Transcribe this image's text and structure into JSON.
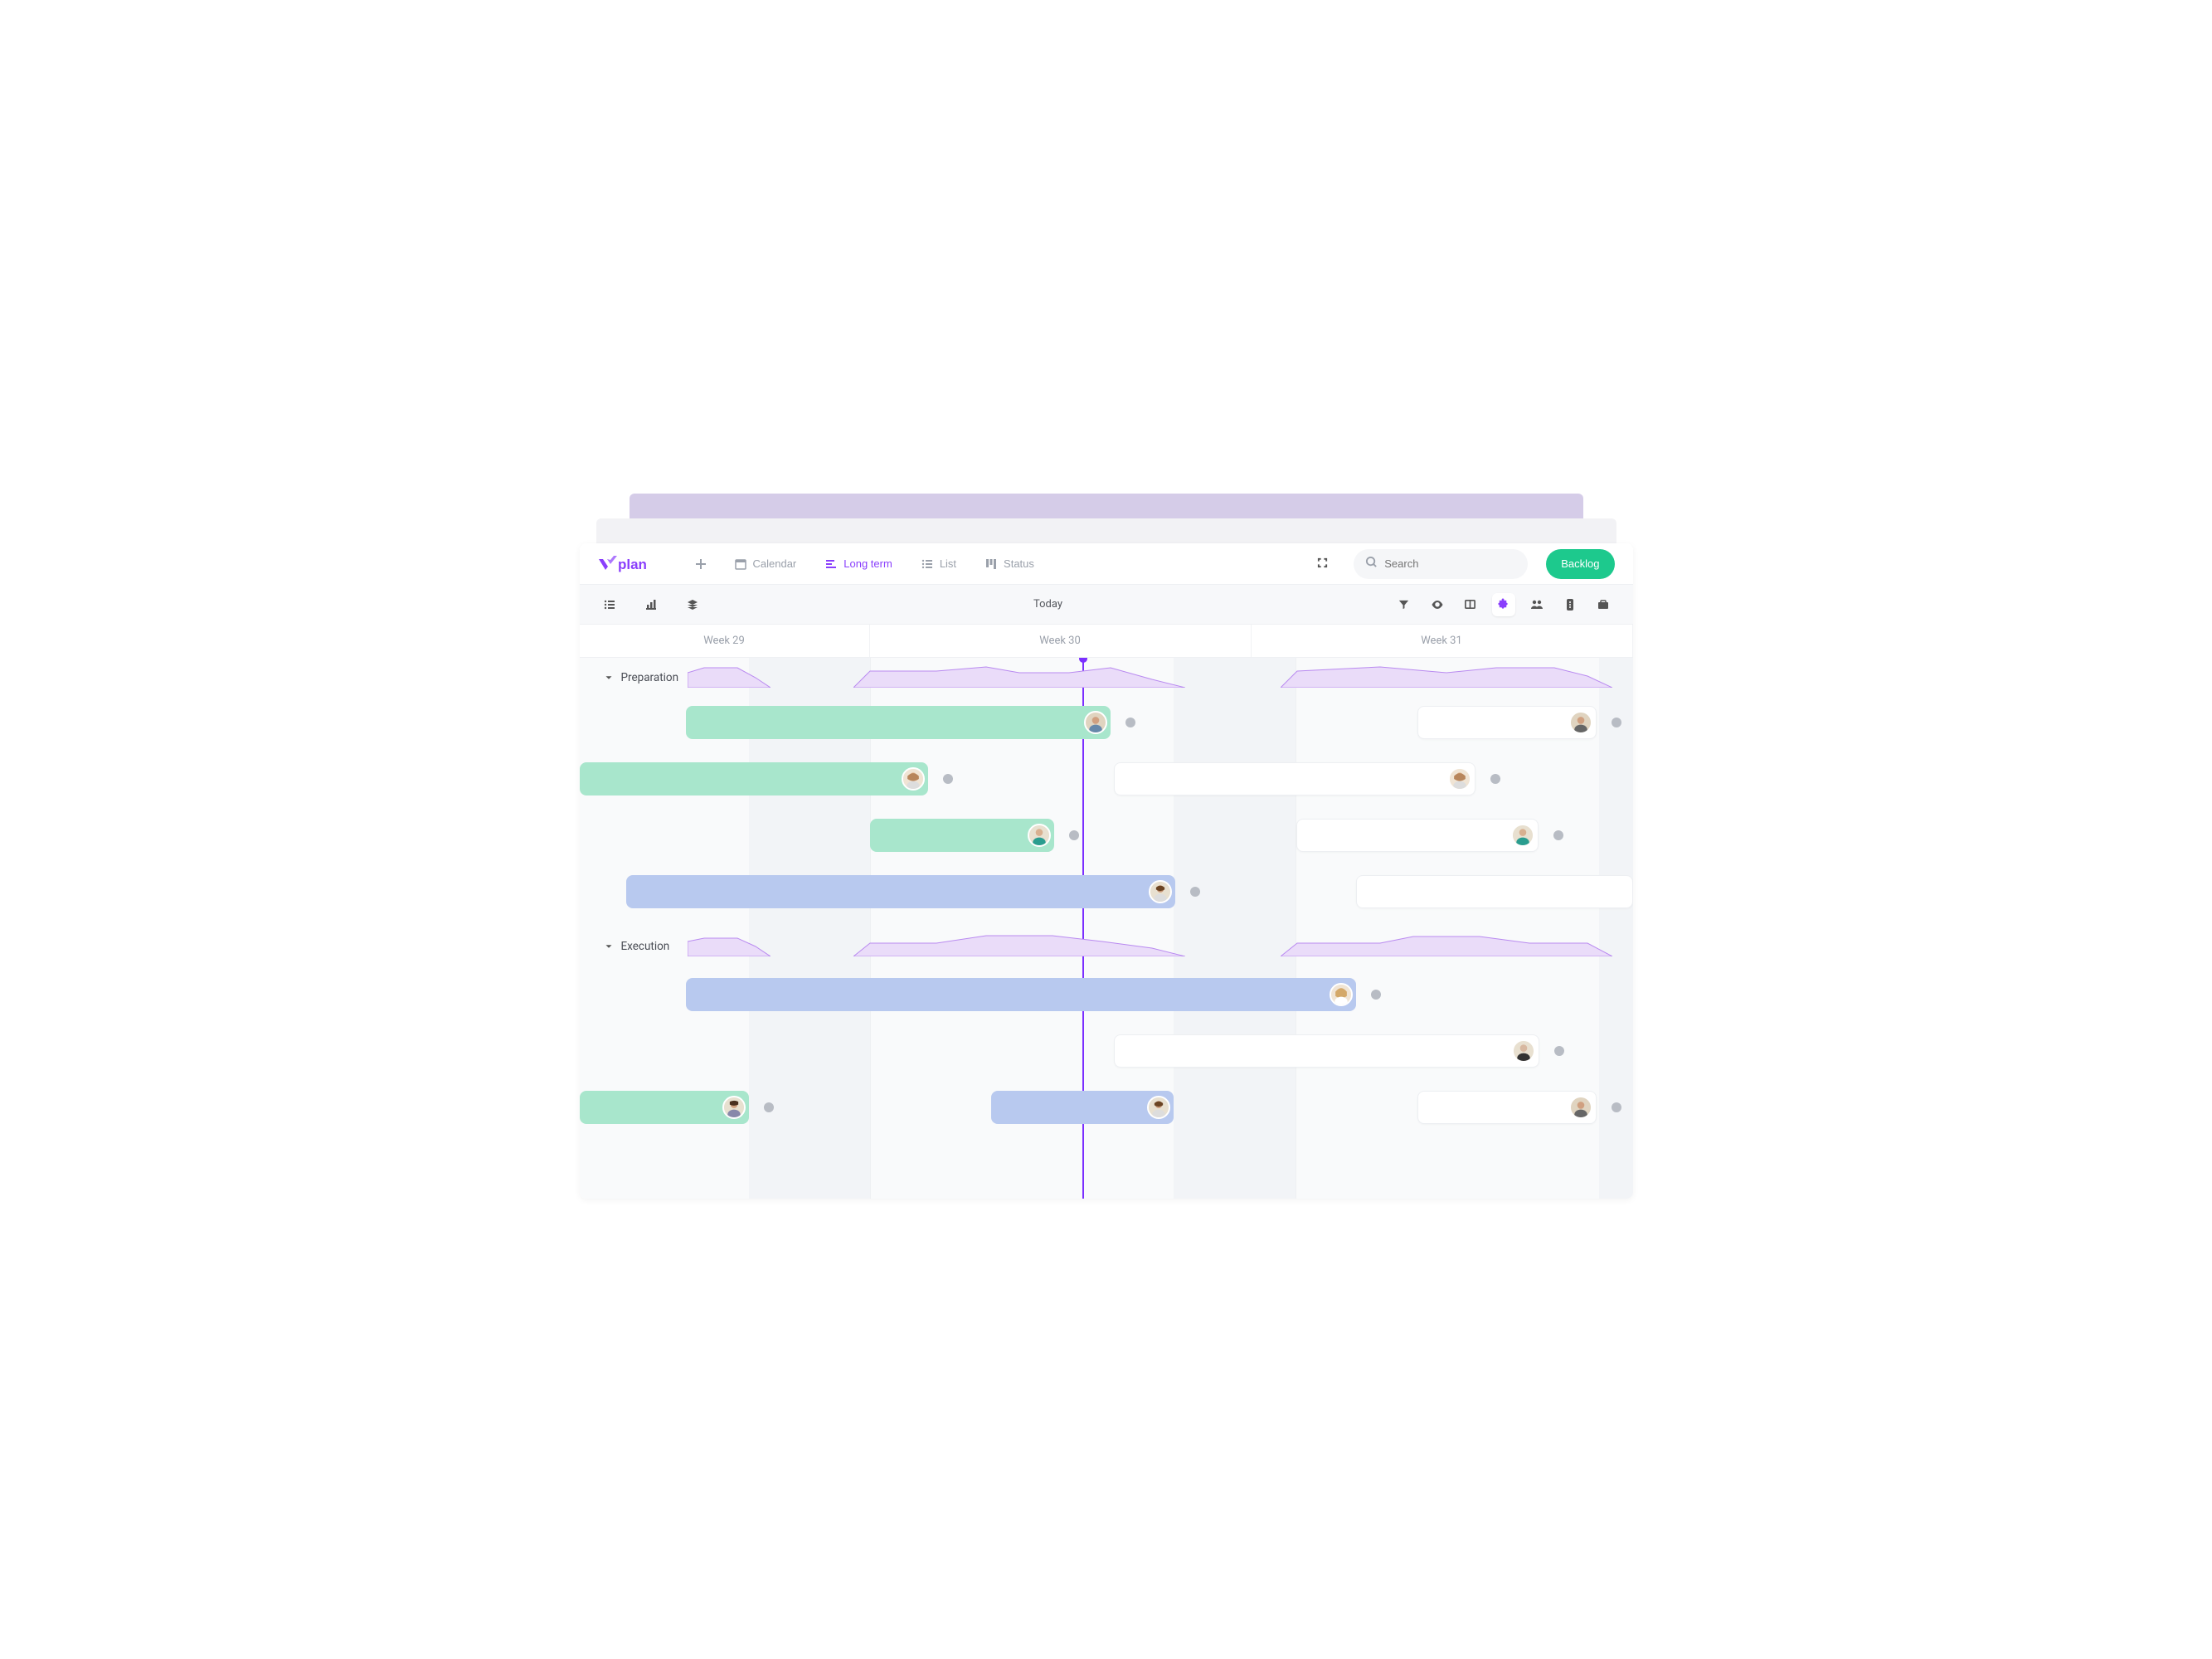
{
  "brand": "vplan",
  "nav": {
    "calendar": "Calendar",
    "long_term": "Long term",
    "list": "List",
    "status": "Status"
  },
  "search": {
    "placeholder": "Search"
  },
  "backlog": "Backlog",
  "toolbar": {
    "today": "Today"
  },
  "weeks": [
    "Week 29",
    "Week 30",
    "Week 31"
  ],
  "groups": {
    "preparation": "Preparation",
    "execution": "Execution"
  },
  "colors": {
    "primary": "#8a3ffc",
    "green": "#a8e6cc",
    "blue": "#b8c9ef",
    "accent": "#1dc98d"
  }
}
